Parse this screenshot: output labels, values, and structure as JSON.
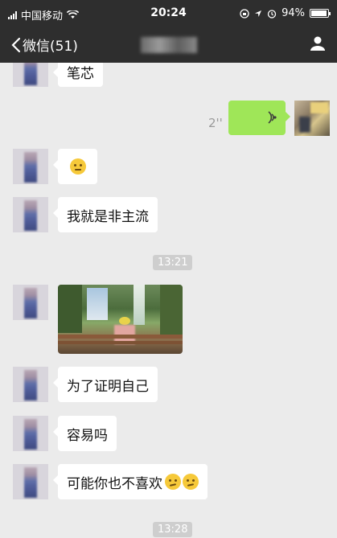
{
  "status_bar": {
    "carrier": "中国移动",
    "time": "20:24",
    "battery": "94%",
    "battery_level": 0.94
  },
  "nav": {
    "back_label": "微信(51)"
  },
  "messages": [
    {
      "type": "text",
      "text": "笔芯"
    },
    {
      "type": "voice",
      "duration": "2''"
    },
    {
      "type": "emoji"
    },
    {
      "type": "text",
      "text": "我就是非主流"
    },
    {
      "type": "timestamp",
      "text": "13:21"
    },
    {
      "type": "image"
    },
    {
      "type": "text",
      "text": "为了证明自己"
    },
    {
      "type": "text",
      "text": "容易吗"
    },
    {
      "type": "text",
      "text": "可能你也不喜欢"
    },
    {
      "type": "timestamp",
      "text": "13:28"
    }
  ],
  "colors": {
    "bar": "#2e2e2e",
    "chat_bg": "#ebebeb",
    "outgoing_bubble": "#9fe658",
    "incoming_bubble": "#ffffff"
  }
}
